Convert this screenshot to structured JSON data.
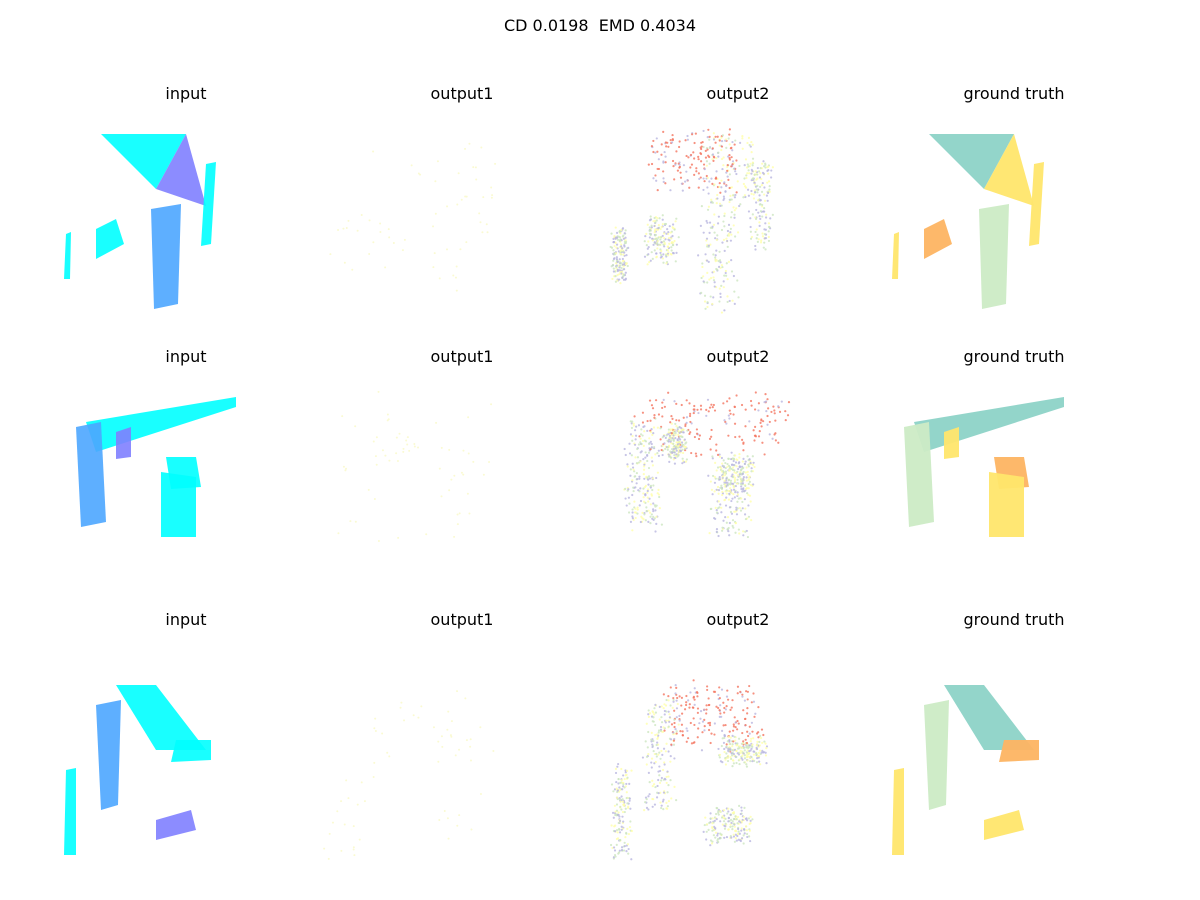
{
  "figure": {
    "suptitle": "CD 0.0198  EMD 0.4034",
    "column_titles": [
      "input",
      "output1",
      "output2",
      "ground truth"
    ],
    "rows": 3
  },
  "colors": {
    "input_cyan": "#00ffff",
    "input_blue": "#4da6ff",
    "input_violet": "#7f7fff",
    "output2_red": "#f47560",
    "output2_lavender": "#b9b6e0",
    "output2_yellow": "#ffffaa",
    "output2_green": "#cde6c0",
    "gt_teal": "#8dd3c7",
    "gt_yellow": "#ffe66b",
    "gt_orange": "#fdb462",
    "gt_lightgreen": "#ccebc5",
    "gt_purple": "#bc80bd",
    "output1_faint": "#fafad2"
  }
}
